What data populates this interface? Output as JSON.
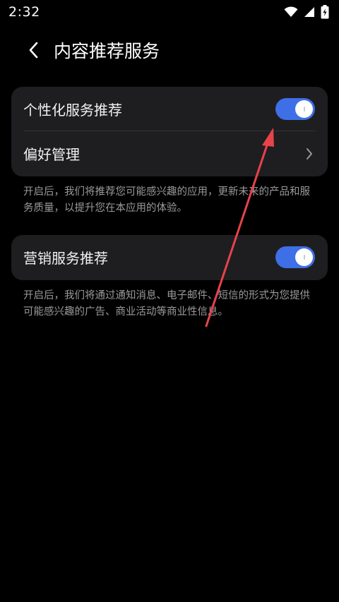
{
  "status_bar": {
    "time": "2:32",
    "icons": [
      "wifi-icon",
      "cellular-signal-icon",
      "battery-charging-icon"
    ]
  },
  "header": {
    "back_icon": "chevron-left-icon",
    "title": "内容推荐服务"
  },
  "sections": [
    {
      "rows": [
        {
          "label": "个性化服务推荐",
          "control": "toggle",
          "enabled": true
        },
        {
          "label": "偏好管理",
          "control": "chevron-right-icon"
        }
      ],
      "description": "开启后，我们将推荐您可能感兴趣的应用，更新未来的产品和服务质量，以提升您在本应用的体验。"
    },
    {
      "rows": [
        {
          "label": "营销服务推荐",
          "control": "toggle",
          "enabled": true
        }
      ],
      "description": "开启后，我们将通过通知消息、电子邮件、短信的形式为您提供可能感兴趣的广告、商业活动等商业性信息。"
    }
  ],
  "colors": {
    "background": "#000000",
    "card": "#1e1e20",
    "toggle_on": "#3e6fe6",
    "secondary_text": "#9a9a9e",
    "annotation_arrow": "#e8424a"
  }
}
